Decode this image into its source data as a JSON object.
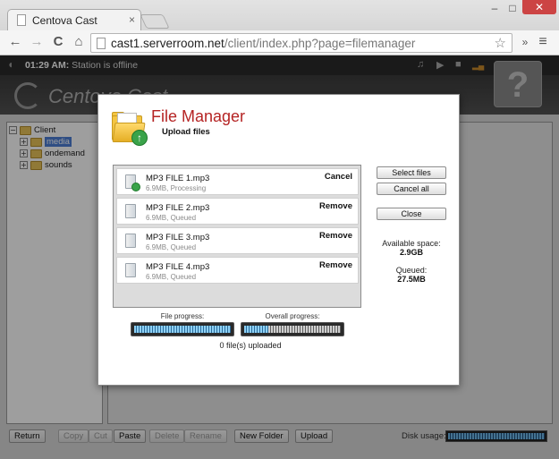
{
  "browser": {
    "tab_title": "Centova Cast",
    "tab_close": "×",
    "url_host": "cast1.serverroom.net",
    "url_rest": "/client/index.php?page=filemanager",
    "star": "☆",
    "minimize": "–",
    "maximize": "□",
    "close": "✕",
    "back": "←",
    "forward": "→",
    "reload": "C",
    "home": "⌂",
    "more": "»",
    "menu": "≡"
  },
  "status": {
    "time": "01:29 AM:",
    "message": "Station is offline",
    "help": "?"
  },
  "player": {
    "music": "♫",
    "play": "▶",
    "stop": "■",
    "signal": "▂▄"
  },
  "logo": {
    "text": "Centova Cast"
  },
  "sidebar": {
    "expander_minus": "−",
    "expander_plus": "+",
    "root": "Client",
    "items": [
      {
        "label": "media",
        "selected": true
      },
      {
        "label": "ondemand",
        "selected": false
      },
      {
        "label": "sounds",
        "selected": false
      }
    ]
  },
  "bottom": {
    "buttons": [
      {
        "label": "Return",
        "disabled": false
      },
      {
        "label": "Copy",
        "disabled": true
      },
      {
        "label": "Cut",
        "disabled": true
      },
      {
        "label": "Paste",
        "disabled": false
      },
      {
        "label": "Delete",
        "disabled": true
      },
      {
        "label": "Rename",
        "disabled": true
      },
      {
        "label": "New Folder",
        "disabled": false
      },
      {
        "label": "Upload",
        "disabled": false
      }
    ],
    "disk_label": "Disk usage:",
    "disk_usage_fraction": 1.0
  },
  "modal": {
    "title": "File Manager",
    "subtitle": "Upload files",
    "upload_arrow": "↑",
    "queue": [
      {
        "name": "MP3 FILE 1.mp3",
        "info": "6.9MB, Processing",
        "action": "Cancel",
        "active": true
      },
      {
        "name": "MP3 FILE 2.mp3",
        "info": "6.9MB, Queued",
        "action": "Remove",
        "active": false
      },
      {
        "name": "MP3 FILE 3.mp3",
        "info": "6.9MB, Queued",
        "action": "Remove",
        "active": false
      },
      {
        "name": "MP3 FILE 4.mp3",
        "info": "6.9MB, Queued",
        "action": "Remove",
        "active": false
      }
    ],
    "buttons": {
      "select_files": "Select files",
      "cancel_all": "Cancel all",
      "close": "Close"
    },
    "available_space_label": "Available space:",
    "available_space_value": "2.9GB",
    "queued_label": "Queued:",
    "queued_value": "27.5MB",
    "file_progress_label": "File progress:",
    "file_progress_fraction": 1.0,
    "overall_progress_label": "Overall progress:",
    "overall_progress_fraction": 0.25,
    "files_uploaded": "0 file(s) uploaded"
  }
}
